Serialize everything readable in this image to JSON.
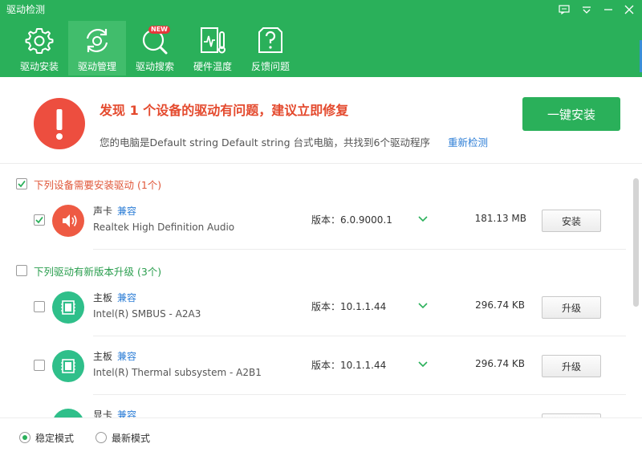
{
  "window": {
    "title": "驱动检测"
  },
  "tabs": [
    {
      "label": "驱动安装",
      "icon": "gear-icon",
      "active": false
    },
    {
      "label": "驱动管理",
      "icon": "refresh-gear-icon",
      "active": true
    },
    {
      "label": "驱动搜索",
      "icon": "search-icon",
      "badge": "NEW",
      "active": false
    },
    {
      "label": "硬件温度",
      "icon": "thermometer-icon",
      "active": false
    },
    {
      "label": "反馈问题",
      "icon": "question-icon",
      "active": false
    }
  ],
  "alert": {
    "title": "发现 1 个设备的驱动有问题，建议立即修复",
    "subtitle": "您的电脑是Default string Default string 台式电脑，共找到6个驱动程序",
    "recheck_label": "重新检测",
    "install_all_label": "一键安装"
  },
  "sections": [
    {
      "header": "下列设备需要安装驱动 (1个)",
      "checked": true,
      "items": [
        {
          "category": "声卡",
          "compat": "兼容",
          "name": "Realtek High Definition Audio",
          "version": "版本：6.0.9000.1",
          "size": "181.13 MB",
          "action": "安装",
          "checked": true,
          "icon": "speaker-icon"
        }
      ]
    },
    {
      "header": "下列驱动有新版本升级 (3个)",
      "checked": false,
      "items": [
        {
          "category": "主板",
          "compat": "兼容",
          "name": "Intel(R) SMBUS - A2A3",
          "version": "版本：10.1.1.44",
          "size": "296.74 KB",
          "action": "升级",
          "checked": false,
          "icon": "chip-icon"
        },
        {
          "category": "主板",
          "compat": "兼容",
          "name": "Intel(R) Thermal subsystem - A2B1",
          "version": "版本：10.1.1.44",
          "size": "296.74 KB",
          "action": "升级",
          "checked": false,
          "icon": "chip-icon"
        },
        {
          "category": "显卡",
          "compat": "兼容",
          "name": "",
          "version": "",
          "size": "",
          "action": "",
          "checked": false,
          "icon": "chip-icon"
        }
      ]
    }
  ],
  "footer": {
    "modes": [
      {
        "label": "稳定模式",
        "selected": true
      },
      {
        "label": "最新模式",
        "selected": false
      }
    ]
  },
  "colors": {
    "brand_green": "#2ab05a",
    "alert_red": "#ed4e3f",
    "link_blue": "#2d7ed6"
  }
}
